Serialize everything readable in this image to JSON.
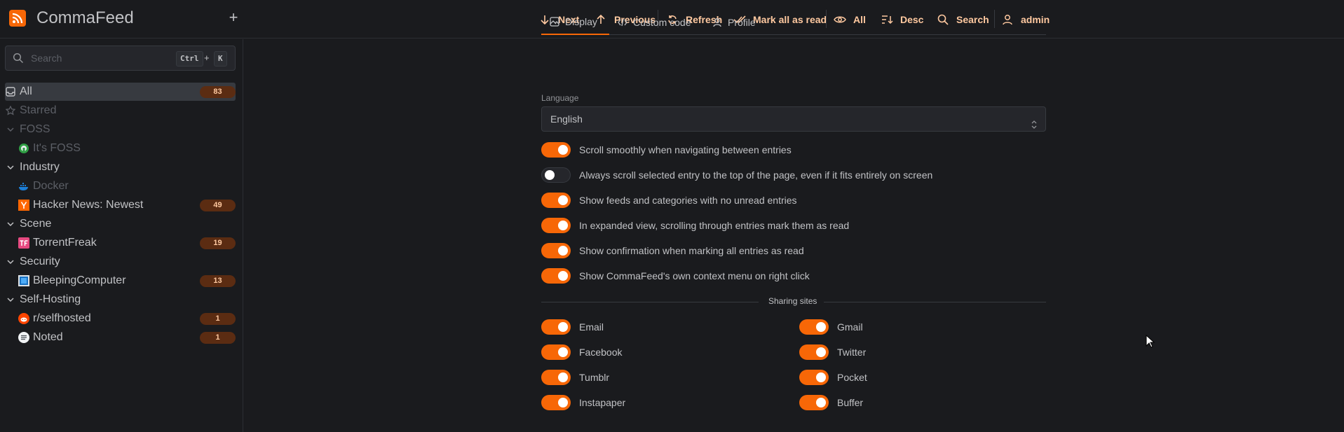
{
  "app": {
    "title": "CommaFeed"
  },
  "toolbar": {
    "next": "Next",
    "previous": "Previous",
    "refresh": "Refresh",
    "mark_all_read": "Mark all as read",
    "filter": "All",
    "order": "Desc",
    "search": "Search",
    "user": "admin"
  },
  "sidebar": {
    "search": {
      "placeholder": "Search",
      "shortcut_key1": "Ctrl",
      "shortcut_plus": "+",
      "shortcut_key2": "K"
    },
    "items": [
      {
        "label": "All",
        "badge": "83",
        "kind": "all"
      },
      {
        "label": "Starred",
        "kind": "starred"
      },
      {
        "label": "FOSS",
        "kind": "category"
      },
      {
        "label": "It's FOSS",
        "kind": "feed"
      },
      {
        "label": "Industry",
        "kind": "category"
      },
      {
        "label": "Docker",
        "kind": "feed"
      },
      {
        "label": "Hacker News: Newest",
        "badge": "49",
        "kind": "feed"
      },
      {
        "label": "Scene",
        "kind": "category"
      },
      {
        "label": "TorrentFreak",
        "badge": "19",
        "kind": "feed"
      },
      {
        "label": "Security",
        "kind": "category"
      },
      {
        "label": "BleepingComputer",
        "badge": "13",
        "kind": "feed"
      },
      {
        "label": "Self-Hosting",
        "kind": "category"
      },
      {
        "label": "r/selfhosted",
        "badge": "1",
        "kind": "feed"
      },
      {
        "label": "Noted",
        "badge": "1",
        "kind": "feed"
      }
    ]
  },
  "settings": {
    "tabs": [
      {
        "label": "Display",
        "icon": "photo-icon"
      },
      {
        "label": "Custom code",
        "icon": "code-icon"
      },
      {
        "label": "Profile",
        "icon": "user-icon"
      }
    ],
    "language_label": "Language",
    "language_value": "English",
    "toggles": [
      {
        "label": "Scroll smoothly when navigating between entries",
        "on": true
      },
      {
        "label": "Always scroll selected entry to the top of the page, even if it fits entirely on screen",
        "on": false
      },
      {
        "label": "Show feeds and categories with no unread entries",
        "on": true
      },
      {
        "label": "In expanded view, scrolling through entries mark them as read",
        "on": true
      },
      {
        "label": "Show confirmation when marking all entries as read",
        "on": true
      },
      {
        "label": "Show CommaFeed's own context menu on right click",
        "on": true
      }
    ],
    "sharing_label": "Sharing sites",
    "sharing": [
      {
        "label": "Email",
        "on": true
      },
      {
        "label": "Gmail",
        "on": true
      },
      {
        "label": "Facebook",
        "on": true
      },
      {
        "label": "Twitter",
        "on": true
      },
      {
        "label": "Tumblr",
        "on": true
      },
      {
        "label": "Pocket",
        "on": true
      },
      {
        "label": "Instapaper",
        "on": true
      },
      {
        "label": "Buffer",
        "on": true
      }
    ]
  },
  "colors": {
    "accent": "#f76707",
    "badge_bg": "#5b2c12",
    "badge_text": "#ffc9a0",
    "background": "#1a1b1e"
  }
}
